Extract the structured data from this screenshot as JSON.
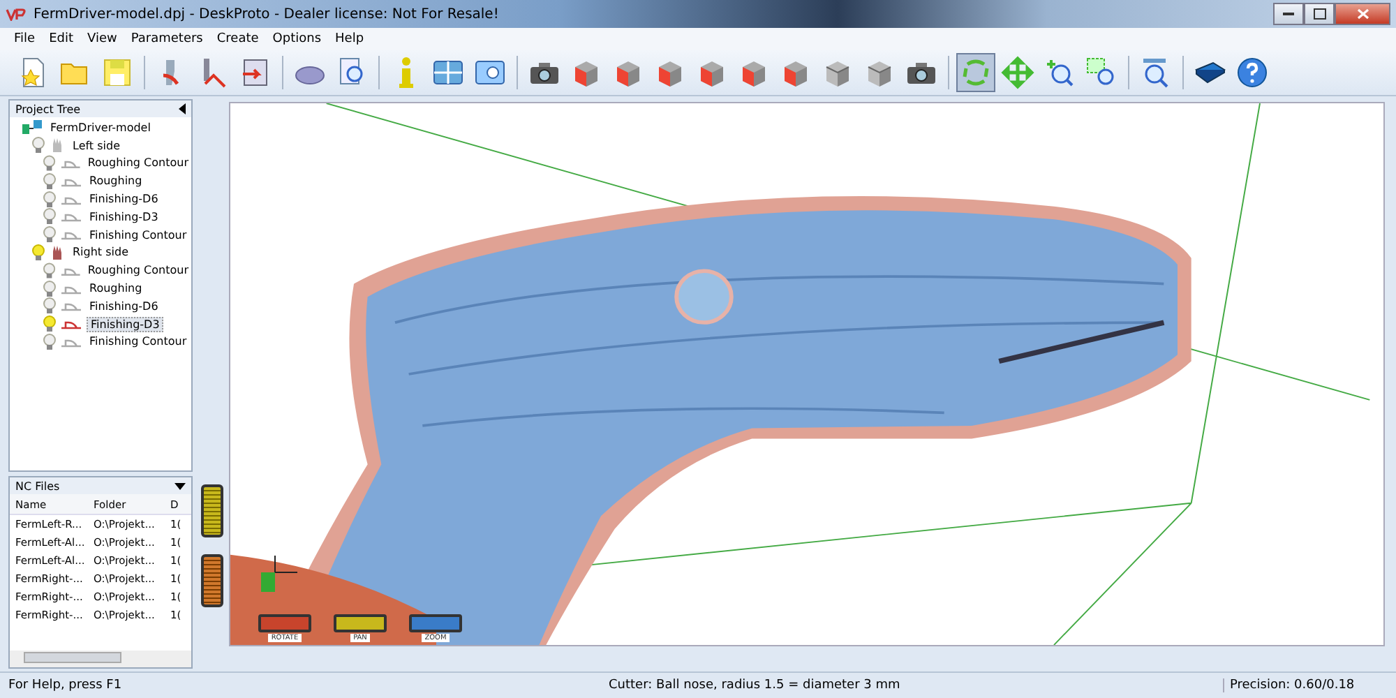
{
  "window": {
    "title": "FermDriver-model.dpj - DeskProto - Dealer license: Not For Resale!"
  },
  "menu": [
    "File",
    "Edit",
    "View",
    "Parameters",
    "Create",
    "Options",
    "Help"
  ],
  "toolbar": [
    {
      "buttons": [
        {
          "kind": "new",
          "selected": false
        },
        {
          "kind": "open",
          "selected": false
        },
        {
          "kind": "save",
          "selected": false
        }
      ]
    },
    {
      "buttons": [
        {
          "kind": "part",
          "selected": false
        },
        {
          "kind": "tool",
          "selected": false
        },
        {
          "kind": "export",
          "selected": false
        }
      ]
    },
    {
      "buttons": [
        {
          "kind": "print",
          "selected": false
        },
        {
          "kind": "preview",
          "selected": false
        }
      ]
    },
    {
      "buttons": [
        {
          "kind": "info",
          "selected": false
        },
        {
          "kind": "windows",
          "selected": false
        },
        {
          "kind": "zoomwin",
          "selected": false
        }
      ]
    },
    {
      "buttons": [
        {
          "kind": "camera",
          "selected": false
        },
        {
          "kind": "cube",
          "selected": false
        },
        {
          "kind": "cube",
          "selected": false
        },
        {
          "kind": "cube",
          "selected": false
        },
        {
          "kind": "cube",
          "selected": false
        },
        {
          "kind": "cube",
          "selected": false
        },
        {
          "kind": "cube",
          "selected": false
        },
        {
          "kind": "greycube",
          "selected": false
        },
        {
          "kind": "greycube",
          "selected": false
        },
        {
          "kind": "camera",
          "selected": false
        }
      ]
    },
    {
      "buttons": [
        {
          "kind": "rotate",
          "selected": true
        },
        {
          "kind": "pan",
          "selected": false
        },
        {
          "kind": "zoom",
          "selected": false
        },
        {
          "kind": "zoombox",
          "selected": false
        }
      ]
    },
    {
      "buttons": [
        {
          "kind": "zoomall",
          "selected": false
        }
      ]
    },
    {
      "buttons": [
        {
          "kind": "book",
          "selected": false
        },
        {
          "kind": "help",
          "selected": false
        }
      ]
    }
  ],
  "project_tree": {
    "title": "Project Tree",
    "items": [
      {
        "label": "FermDriver-model",
        "selected": false,
        "children": [
          {
            "label": "Left side",
            "lit": false,
            "selected": false,
            "children": [
              {
                "label": "Roughing Contour",
                "lit": false,
                "selected": false
              },
              {
                "label": "Roughing",
                "lit": false,
                "selected": false
              },
              {
                "label": "Finishing-D6",
                "lit": false,
                "selected": false
              },
              {
                "label": "Finishing-D3",
                "lit": false,
                "selected": false
              },
              {
                "label": "Finishing Contour",
                "lit": false,
                "selected": false
              }
            ]
          },
          {
            "label": "Right side",
            "lit": true,
            "selected": false,
            "children": [
              {
                "label": "Roughing Contour",
                "lit": false,
                "selected": false
              },
              {
                "label": "Roughing",
                "lit": false,
                "selected": false
              },
              {
                "label": "Finishing-D6",
                "lit": false,
                "selected": false
              },
              {
                "label": "Finishing-D3",
                "lit": true,
                "selected": true
              },
              {
                "label": "Finishing Contour",
                "lit": false,
                "selected": false
              }
            ]
          }
        ]
      }
    ]
  },
  "nc_files": {
    "title": "NC Files",
    "columns": [
      "Name",
      "Folder",
      "D"
    ],
    "rows": [
      [
        "FermLeft-R...",
        "O:\\Projekt...",
        "1("
      ],
      [
        "FermLeft-Al...",
        "O:\\Projekt...",
        "1("
      ],
      [
        "FermLeft-Al...",
        "O:\\Projekt...",
        "1("
      ],
      [
        "FermRight-...",
        "O:\\Projekt...",
        "1("
      ],
      [
        "FermRight-...",
        "O:\\Projekt...",
        "1("
      ],
      [
        "FermRight-...",
        "O:\\Projekt...",
        "1("
      ]
    ]
  },
  "dials": [
    {
      "label": "ROTATE",
      "color": "#c8442c"
    },
    {
      "label": "PAN",
      "color": "#c8b81c"
    },
    {
      "label": "ZOOM",
      "color": "#3a7cc8"
    }
  ],
  "status_bar": {
    "help": "For Help, press F1",
    "cutter": "Cutter: Ball nose, radius 1.5 = diameter 3 mm",
    "precision": "Precision: 0.60/0.18"
  }
}
